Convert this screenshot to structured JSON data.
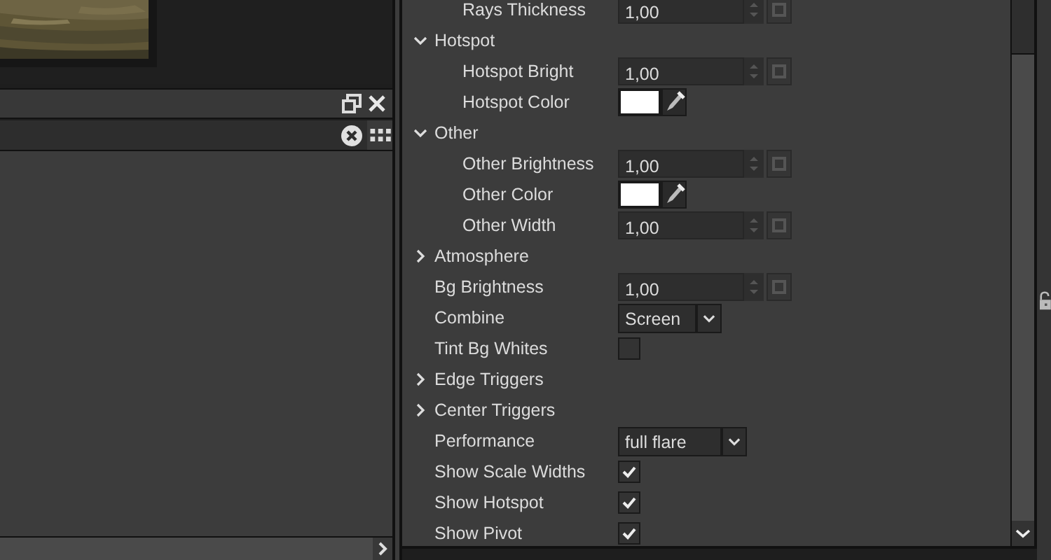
{
  "properties": [
    {
      "kind": "group",
      "children": [
        {
          "kind": "number",
          "label": "Rays Thickness",
          "value": "1,00"
        }
      ]
    },
    {
      "kind": "group",
      "label": "Hotspot",
      "expanded": true,
      "children": [
        {
          "kind": "number",
          "label": "Hotspot Bright",
          "value": "1,00"
        },
        {
          "kind": "color",
          "label": "Hotspot Color",
          "color": "#ffffff"
        }
      ]
    },
    {
      "kind": "group",
      "label": "Other",
      "expanded": true,
      "children": [
        {
          "kind": "number",
          "label": "Other Brightness",
          "value": "1,00"
        },
        {
          "kind": "color",
          "label": "Other Color",
          "color": "#ffffff"
        },
        {
          "kind": "number",
          "label": "Other Width",
          "value": "1,00"
        }
      ]
    },
    {
      "kind": "group",
      "label": "Atmosphere",
      "expanded": false
    },
    {
      "kind": "number",
      "label": "Bg Brightness",
      "value": "1,00"
    },
    {
      "kind": "select",
      "label": "Combine",
      "value": "Screen"
    },
    {
      "kind": "checkbox",
      "label": "Tint Bg Whites",
      "checked": false
    },
    {
      "kind": "group",
      "label": "Edge Triggers",
      "expanded": false
    },
    {
      "kind": "group",
      "label": "Center Triggers",
      "expanded": false
    },
    {
      "kind": "select",
      "label": "Performance",
      "value": "full flare"
    },
    {
      "kind": "checkbox",
      "label": "Show Scale Widths",
      "checked": true
    },
    {
      "kind": "checkbox",
      "label": "Show Hotspot",
      "checked": true
    },
    {
      "kind": "checkbox",
      "label": "Show Pivot",
      "checked": true
    }
  ]
}
